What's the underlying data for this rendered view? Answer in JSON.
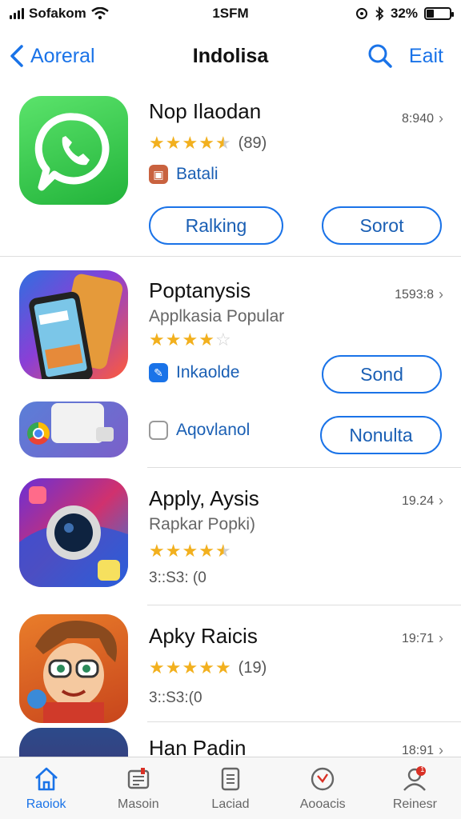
{
  "status_bar": {
    "carrier": "Sofakom",
    "time": "1SFM",
    "battery": "32%",
    "battery_level": 0.32,
    "icons": [
      "signal-icon",
      "wifi-icon",
      "location-icon",
      "bluetooth-icon",
      "battery-icon"
    ]
  },
  "nav": {
    "back_label": "Aoreral",
    "title": "Indolisa",
    "edit_label": "Eait"
  },
  "apps": [
    {
      "title": "Nop Ilaodan",
      "time": "8:940",
      "rating": 4.5,
      "rating_count": "(89)",
      "tag": "Batali",
      "buttons": [
        "Ralking",
        "Sorot"
      ]
    },
    {
      "title": "Poptanysis",
      "subtitle": "Applkasia Popular",
      "time": "1593:8",
      "rating": 4,
      "tag": "Inkaolde",
      "button": "Sond"
    },
    {
      "tag": "Aqovlanol",
      "button": "Nonulta"
    },
    {
      "title": "Apply, Aysis",
      "subtitle": "Rapkar Popki)",
      "time": "19.24",
      "rating": 4.5,
      "meta": "3::S3: (0"
    },
    {
      "title": "Apky Raicis",
      "time": "19:71",
      "rating": 5,
      "rating_count": "(19)",
      "meta": "3::S3:(0"
    },
    {
      "title": "Han Padin",
      "time": "18:91"
    }
  ],
  "tabs": [
    {
      "label": "Raoiok",
      "icon": "home-icon",
      "active": true
    },
    {
      "label": "Masoin",
      "icon": "news-icon",
      "active": false
    },
    {
      "label": "Laciad",
      "icon": "document-icon",
      "active": false
    },
    {
      "label": "Aooacis",
      "icon": "clock-icon",
      "active": false
    },
    {
      "label": "Reinesr",
      "icon": "profile-icon",
      "active": false,
      "badge": "1"
    }
  ],
  "colors": {
    "accent": "#1a73e8",
    "star": "#f2b01e",
    "whatsapp_green": "#3ccf4e"
  }
}
